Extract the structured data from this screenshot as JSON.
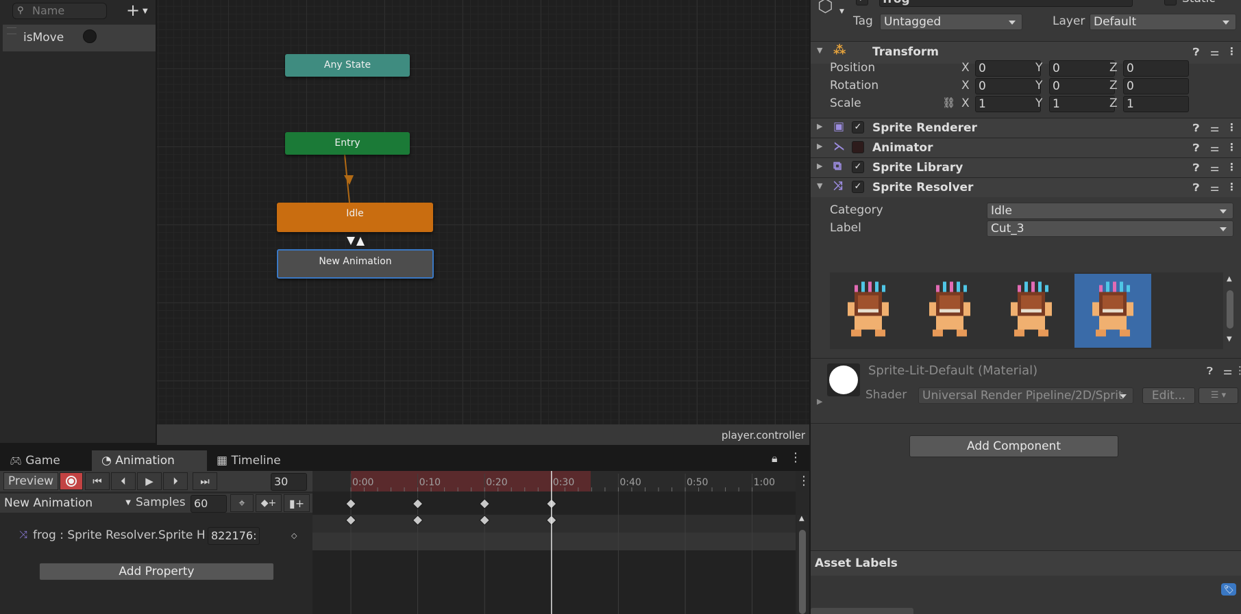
{
  "params": {
    "search_placeholder": "Name",
    "add_label": "+",
    "items": [
      {
        "label": "isMove"
      }
    ]
  },
  "graph": {
    "nodes": {
      "any_state": "Any State",
      "entry": "Entry",
      "idle": "Idle",
      "new_animation": "New Animation"
    },
    "footer": "player.controller"
  },
  "tabs": [
    {
      "label": "Game",
      "icon": "gamepad-icon"
    },
    {
      "label": "Animation",
      "icon": "clock-icon"
    },
    {
      "label": "Timeline",
      "icon": "film-icon"
    }
  ],
  "animation": {
    "preview_label": "Preview",
    "frame_value": "30",
    "clip_name": "New Animation",
    "samples_label": "Samples",
    "samples_value": "60",
    "property_label": "frog : Sprite Resolver.Sprite H",
    "property_value": "822176:",
    "add_property_label": "Add Property",
    "ruler_ticks": [
      "0:00",
      "0:10",
      "0:20",
      "0:30",
      "0:40",
      "0:50",
      "1:00"
    ],
    "keyframe_times": [
      "0:00",
      "0:10",
      "0:20",
      "0:30"
    ],
    "playhead_time": "0:30"
  },
  "inspector": {
    "object_name": "frog",
    "static_label": "Static",
    "tag_label": "Tag",
    "tag_value": "Untagged",
    "layer_label": "Layer",
    "layer_value": "Default",
    "transform": {
      "title": "Transform",
      "rows": [
        {
          "label": "Position",
          "x": "0",
          "y": "0",
          "z": "0"
        },
        {
          "label": "Rotation",
          "x": "0",
          "y": "0",
          "z": "0"
        },
        {
          "label": "Scale",
          "x": "1",
          "y": "1",
          "z": "1"
        }
      ],
      "axis": [
        "X",
        "Y",
        "Z"
      ]
    },
    "components": [
      {
        "title": "Sprite Renderer",
        "checked": true
      },
      {
        "title": "Animator",
        "checked": false
      },
      {
        "title": "Sprite Library",
        "checked": true
      },
      {
        "title": "Sprite Resolver",
        "checked": true
      }
    ],
    "resolver": {
      "category_label": "Category",
      "category_value": "Idle",
      "label_label": "Label",
      "label_value": "Cut_3",
      "selected_index": 3
    },
    "material": {
      "name": "Sprite-Lit-Default (Material)",
      "shader_label": "Shader",
      "shader_value": "Universal Render Pipeline/2D/Sprit",
      "edit_label": "Edit..."
    },
    "add_component_label": "Add Component",
    "asset_labels_title": "Asset Labels"
  },
  "colors": {
    "any_state": "#3f8c80",
    "entry": "#1b7a37",
    "idle": "#c96d10",
    "new_animation": "#4d4d4d",
    "selection": "#3a78c4",
    "record": "#d73434",
    "playhead": "#e0e0e0"
  }
}
